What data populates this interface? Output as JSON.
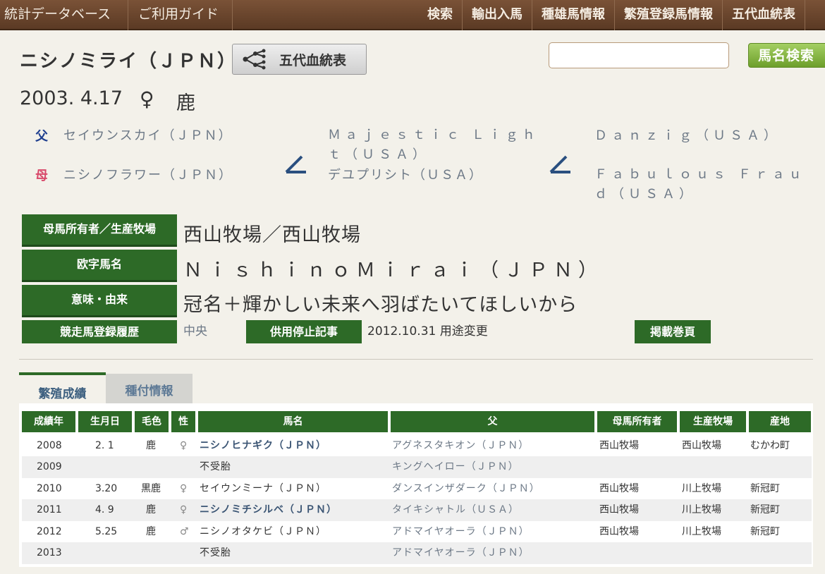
{
  "nav": {
    "left": [
      "統計データベース",
      "ご利用ガイド"
    ],
    "right": [
      "検索",
      "輸出入馬",
      "種雄馬情報",
      "繁殖登録馬情報",
      "五代血統表"
    ]
  },
  "header": {
    "horse_name": "ニシノミライ（ＪＰＮ）",
    "pedigree_button": "五代血統表",
    "search_button": "馬名検索",
    "search_value": ""
  },
  "birth": {
    "date": "2003. 4.17",
    "sex": "♀",
    "color": "鹿"
  },
  "pedigree": {
    "sire_label": "父",
    "dam_label": "母",
    "sire": "セイウンスカイ（ＪＰＮ）",
    "dam": "ニシノフラワー（ＪＰＮ）",
    "dam_sire": "Ｍａｊｅｓｔｉｃ Ｌｉｇｈｔ（ＵＳＡ）",
    "dam_dam": "デユプリシト（ＵＳＡ）",
    "dam_dam_sire": "Ｄａｎｚｉｇ（ＵＳＡ）",
    "dam_dam_dam": "Ｆａｂｕｌｏｕｓ Ｆｒａｕｄ（ＵＳＡ）"
  },
  "info": {
    "owner_label": "母馬所有者／生産牧場",
    "owner_value": "西山牧場／西山牧場",
    "roman_label": "欧字馬名",
    "roman_value": "ＮｉｓｈｉｎｏＭｉｒａｉ（ＪＰＮ）",
    "meaning_label": "意味・由来",
    "meaning_value": "冠名＋輝かしい未来へ羽ばたいてほしいから",
    "race_label": "競走馬登録履歴",
    "race_value": "中央",
    "retire_label": "供用停止記事",
    "retire_value": "2012.10.31 用途変更",
    "page_label": "掲載巻頁"
  },
  "tabs": {
    "active": "繁殖成績",
    "inactive": "種付情報"
  },
  "table": {
    "headers": [
      "成績年",
      "生月日",
      "毛色",
      "性",
      "馬名",
      "父",
      "母馬所有者",
      "生産牧場",
      "産地"
    ],
    "rows": [
      {
        "year": "2008",
        "birth": "2. 1",
        "color": "鹿",
        "sex": "♀",
        "horse": "ニシノヒナギク（ＪＰＮ）",
        "sire": "アグネスタキオン（ＪＰＮ）",
        "owner": "西山牧場",
        "farm": "西山牧場",
        "place": "むかわ町"
      },
      {
        "year": "2009",
        "birth": "",
        "color": "",
        "sex": "",
        "horse": "不受胎",
        "sire": "キングヘイロー（ＪＰＮ）",
        "owner": "",
        "farm": "",
        "place": ""
      },
      {
        "year": "2010",
        "birth": "3.20",
        "color": "黒鹿",
        "sex": "♀",
        "horse": "セイウンミーナ（ＪＰＮ）",
        "sire": "ダンスインザダーク（ＪＰＮ）",
        "owner": "西山牧場",
        "farm": "川上牧場",
        "place": "新冠町"
      },
      {
        "year": "2011",
        "birth": "4. 9",
        "color": "鹿",
        "sex": "♀",
        "horse": "ニシノミチシルベ（ＪＰＮ）",
        "sire": "タイキシャトル（ＵＳＡ）",
        "owner": "西山牧場",
        "farm": "川上牧場",
        "place": "新冠町"
      },
      {
        "year": "2012",
        "birth": "5.25",
        "color": "鹿",
        "sex": "♂",
        "horse": "ニシノオタケビ（ＪＰＮ）",
        "sire": "アドマイヤオーラ（ＪＰＮ）",
        "owner": "西山牧場",
        "farm": "川上牧場",
        "place": "新冠町"
      },
      {
        "year": "2013",
        "birth": "",
        "color": "",
        "sex": "",
        "horse": "不受胎",
        "sire": "アドマイヤオーラ（ＪＰＮ）",
        "owner": "",
        "farm": "",
        "place": ""
      }
    ]
  },
  "colors": {
    "accent_green": "#2d6a27",
    "nav_brown": "#6b4630",
    "sire_blue": "#1f3f8f",
    "dam_red": "#d8486a"
  }
}
